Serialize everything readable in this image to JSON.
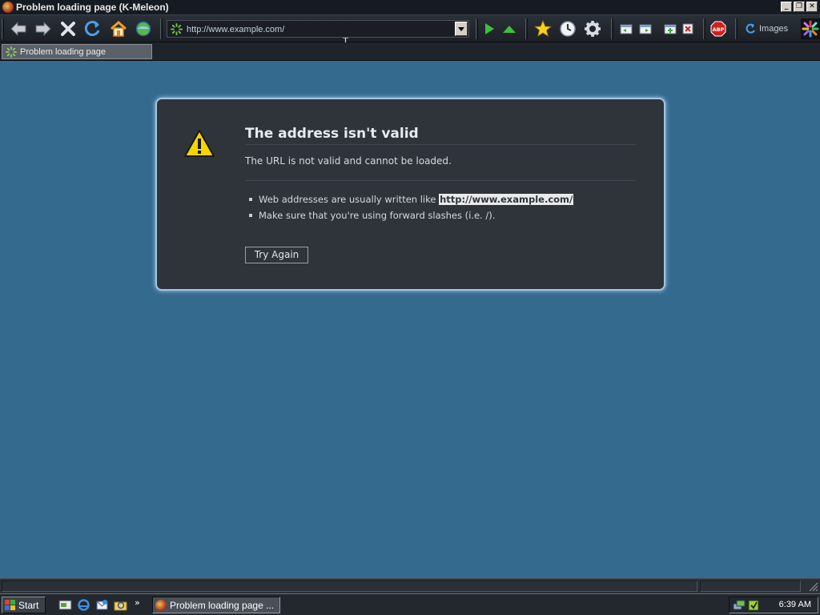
{
  "window": {
    "title": "Problem loading page (K-Meleon)",
    "controls": {
      "minimize": "_",
      "restore": "❐",
      "close": "✕"
    }
  },
  "toolbar": {
    "buttons": [
      "back-icon",
      "forward-icon",
      "stop-icon",
      "reload-icon",
      "home-icon",
      "globe-icon",
      "go-icon",
      "up-icon",
      "bookmarks-star-icon",
      "history-clock-icon",
      "preferences-gear-icon",
      "layer-back-icon",
      "layer-next-icon",
      "new-layer-icon",
      "close-layer-icon",
      "adblock-icon",
      "images-icon",
      "kmeleon-logo-icon"
    ],
    "url": "http://www.example.com/",
    "images_label": "Images"
  },
  "tabs": [
    {
      "label": "Problem loading page",
      "active": true
    }
  ],
  "error": {
    "title": "The address isn't valid",
    "description": "The URL is not valid and cannot be loaded.",
    "bullet1_prefix": "Web addresses are usually written like",
    "bullet1_link": "http://www.example.com/",
    "bullet2": "Make sure that you're using forward slashes (i.e. /).",
    "try_again": "Try Again"
  },
  "taskbar": {
    "start_label": "Start",
    "task_label": "Problem loading page ...",
    "overflow": "»",
    "clock": "6:39 AM"
  },
  "colors": {
    "content_bg": "#356a8f",
    "error_box_bg": "#2f343b",
    "error_box_glow": "#a7d0ee",
    "warning_yellow": "#f5d400"
  }
}
